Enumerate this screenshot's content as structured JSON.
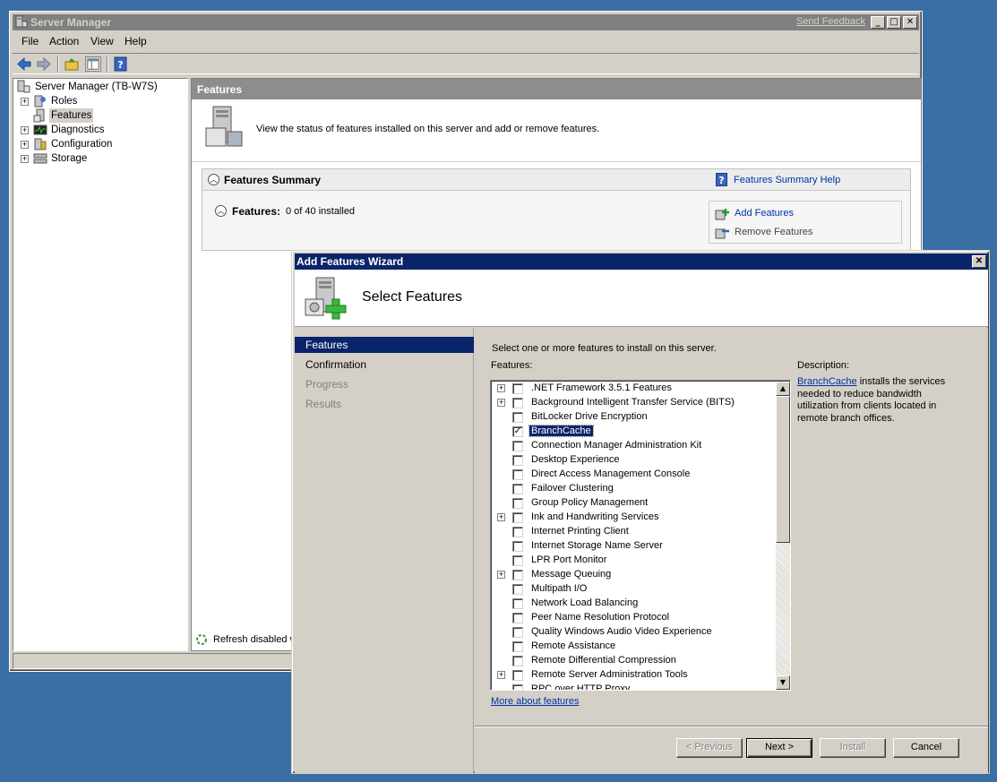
{
  "server_manager": {
    "title": "Server Manager",
    "send_feedback": "Send Feedback",
    "menu": [
      "File",
      "Action",
      "View",
      "Help"
    ],
    "tree": [
      {
        "label": "Server Manager (TB-W7S)",
        "expand": ""
      },
      {
        "label": "Roles",
        "expand": "+"
      },
      {
        "label": "Features",
        "expand": "",
        "selected": true
      },
      {
        "label": "Diagnostics",
        "expand": "+"
      },
      {
        "label": "Configuration",
        "expand": "+"
      },
      {
        "label": "Storage",
        "expand": "+"
      }
    ],
    "content_header": "Features",
    "intro_text": "View the status of features installed on this server and add or remove features.",
    "summary_title": "Features Summary",
    "summary_help": "Features Summary Help",
    "features_label": "Features:",
    "features_count": "0 of 40 installed",
    "add_features": "Add Features",
    "remove_features": "Remove Features",
    "refresh_text": "Refresh disabled w"
  },
  "wizard": {
    "title": "Add Features Wizard",
    "header_title": "Select Features",
    "nav": [
      {
        "label": "Features",
        "state": "active"
      },
      {
        "label": "Confirmation",
        "state": "normal"
      },
      {
        "label": "Progress",
        "state": "disabled"
      },
      {
        "label": "Results",
        "state": "disabled"
      }
    ],
    "instruction": "Select one or more features to install on this server.",
    "features_label": "Features:",
    "description_label": "Description:",
    "description_link": "BranchCache",
    "description_lines": [
      " installs the services",
      "needed to reduce bandwidth",
      "utilization from clients located in",
      "remote branch offices."
    ],
    "features": [
      {
        "label": ".NET Framework 3.5.1 Features",
        "expand": "+",
        "checked": false
      },
      {
        "label": "Background Intelligent Transfer Service (BITS)",
        "expand": "+",
        "checked": false
      },
      {
        "label": "BitLocker Drive Encryption",
        "expand": "",
        "checked": false
      },
      {
        "label": "BranchCache",
        "expand": "",
        "checked": true,
        "selected": true
      },
      {
        "label": "Connection Manager Administration Kit",
        "expand": "",
        "checked": false
      },
      {
        "label": "Desktop Experience",
        "expand": "",
        "checked": false
      },
      {
        "label": "Direct Access Management Console",
        "expand": "",
        "checked": false
      },
      {
        "label": "Failover Clustering",
        "expand": "",
        "checked": false
      },
      {
        "label": "Group Policy Management",
        "expand": "",
        "checked": false
      },
      {
        "label": "Ink and Handwriting Services",
        "expand": "+",
        "checked": false
      },
      {
        "label": "Internet Printing Client",
        "expand": "",
        "checked": false
      },
      {
        "label": "Internet Storage Name Server",
        "expand": "",
        "checked": false
      },
      {
        "label": "LPR Port Monitor",
        "expand": "",
        "checked": false
      },
      {
        "label": "Message Queuing",
        "expand": "+",
        "checked": false
      },
      {
        "label": "Multipath I/O",
        "expand": "",
        "checked": false
      },
      {
        "label": "Network Load Balancing",
        "expand": "",
        "checked": false
      },
      {
        "label": "Peer Name Resolution Protocol",
        "expand": "",
        "checked": false
      },
      {
        "label": "Quality Windows Audio Video Experience",
        "expand": "",
        "checked": false
      },
      {
        "label": "Remote Assistance",
        "expand": "",
        "checked": false
      },
      {
        "label": "Remote Differential Compression",
        "expand": "",
        "checked": false
      },
      {
        "label": "Remote Server Administration Tools",
        "expand": "+",
        "checked": false
      },
      {
        "label": "RPC over HTTP Proxy",
        "expand": "",
        "checked": false
      }
    ],
    "more_link": "More about features",
    "buttons": {
      "previous": "< Previous",
      "next": "Next >",
      "install": "Install",
      "cancel": "Cancel"
    }
  }
}
